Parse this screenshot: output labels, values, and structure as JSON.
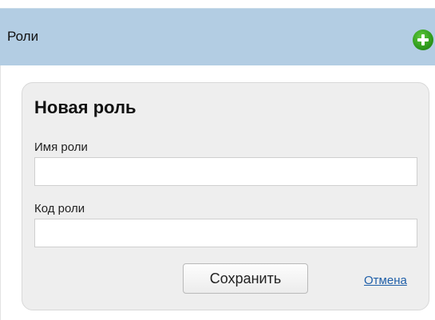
{
  "header": {
    "title": "Роли",
    "add_icon": "plus-circle-icon",
    "add_icon_color": "#2f9a1c",
    "background": "#b3cde3"
  },
  "form": {
    "title": "Новая роль",
    "role_name": {
      "label": "Имя роли",
      "value": ""
    },
    "role_code": {
      "label": "Код роли",
      "value": ""
    },
    "save_label": "Сохранить",
    "cancel_label": "Отмена"
  }
}
